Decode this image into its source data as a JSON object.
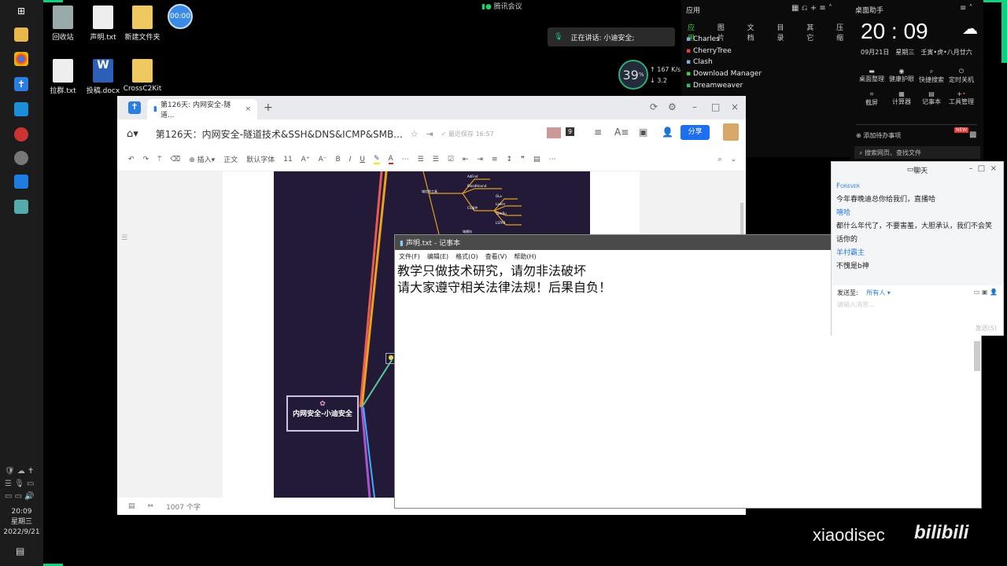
{
  "desktop": {
    "icons": [
      "回收站",
      "声明.txt",
      "新建文件夹",
      "拉群.txt",
      "投稿.docx",
      "CrossC2Kit"
    ],
    "timer": "00:00"
  },
  "meeting": {
    "app": "腾讯会议",
    "speaking": "正在讲话: 小迪安全;"
  },
  "monitor": {
    "cpu": "39",
    "cpu_unit": "%",
    "up": "167",
    "down": "3.2",
    "unit": "K/s"
  },
  "apps_panel": {
    "title": "应用",
    "tabs": [
      "应用",
      "图片",
      "文档",
      "目录",
      "其它",
      "压缩"
    ],
    "items": [
      "Charles",
      "CherryTree",
      "Clash",
      "Download Manager",
      "Dreamweaver"
    ]
  },
  "helper": {
    "title": "桌面助手",
    "time": "20 : 09",
    "date": "09月21日",
    "weekday": "星期三",
    "lunar": "壬寅•虎•八月廿六",
    "tools": [
      "桌面整理",
      "健康护眼",
      "快捷搜索",
      "定时关机",
      "截屏",
      "计算器",
      "记事本",
      "工具管理"
    ],
    "todo": "添加待办事项",
    "new_badge": "NEW",
    "search_placeholder": "搜索网页、查找文件"
  },
  "doc": {
    "tab": "第126天: 内网安全-隧道...",
    "title": "第126天：内网安全-隧道技术&SSH&DNS&ICMP&SMB...",
    "saved": "最近保存 16:57",
    "collab_count": "9",
    "share": "分享",
    "toolbar": [
      "插入",
      "正文",
      "默认字体",
      "11",
      "A⁺",
      "A⁻",
      "B",
      "I",
      "U"
    ],
    "word_count": "1007 个字",
    "mindmap_root": "内网安全-小迪安全",
    "mindmap_nodes": [
      "AdFind",
      "BloodHound",
      "域信息工具",
      "CS插件",
      "OLa",
      "Ladon",
      "TaskRu",
      "LSTAR",
      "域横向"
    ]
  },
  "notepad": {
    "title": "声明.txt - 记事本",
    "menu": [
      "文件(F)",
      "编辑(E)",
      "格式(O)",
      "查看(V)",
      "帮助(H)"
    ],
    "lines": [
      "教学只做技术研究，请勿非法破坏",
      "请大家遵守相关法律法规！后果自负！"
    ]
  },
  "chat": {
    "title": "聊天",
    "messages": [
      {
        "user": "Forever",
        "text": "今年春晚迪总你给我们，直播哈"
      },
      {
        "user": "嘻哈",
        "text": "都什么年代了，不要害羞，大胆承认，我们不会笑话你的"
      },
      {
        "user": "羊村霸主",
        "text": "不愧是b神"
      }
    ],
    "send_to_label": "发送至:",
    "send_to": "所有人",
    "input_placeholder": "请输入消息...",
    "send": "发送(S)"
  },
  "clock": {
    "time": "20:09",
    "weekday": "星期三",
    "date": "2022/9/21"
  },
  "watermark": {
    "text": "xiaodisec",
    "logo": "bilibili"
  }
}
